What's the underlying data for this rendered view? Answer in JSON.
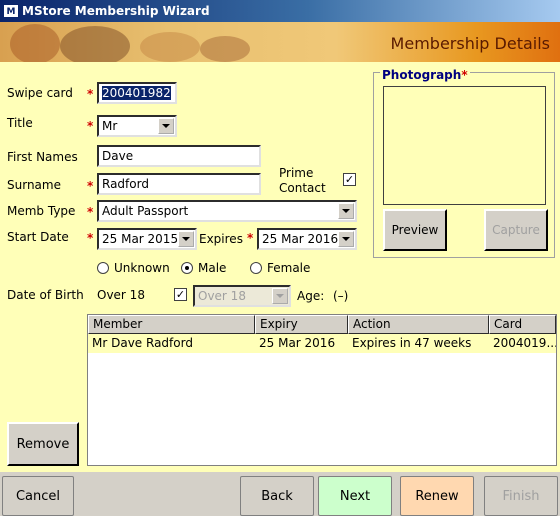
{
  "window": {
    "title": "MStore Membership Wizard",
    "logo": "M"
  },
  "banner": {
    "title": "Membership Details"
  },
  "form": {
    "swipe_card_label": "Swipe card",
    "swipe_card_value": "200401982",
    "title_label": "Title",
    "title_value": "Mr",
    "first_names_label": "First Names",
    "first_names_value": "Dave",
    "surname_label": "Surname",
    "surname_value": "Radford",
    "prime_contact_label_1": "Prime",
    "prime_contact_label_2": "Contact",
    "prime_contact_checked": "✓",
    "memb_type_label": "Memb Type",
    "memb_type_value": "Adult Passport",
    "start_date_label": "Start Date",
    "start_date_value": "25 Mar 2015",
    "expires_label": "Expires",
    "expires_value": "25 Mar 2016",
    "gender_unknown": "Unknown",
    "gender_male": "Male",
    "gender_female": "Female",
    "dob_label": "Date of Birth",
    "over18_label": "Over 18",
    "over18_checked": "✓",
    "over18_combo_value": "Over 18",
    "age_label": "Age:",
    "age_value": "(–)",
    "required_mark": "*"
  },
  "photo": {
    "legend": "Photograph",
    "preview_button": "Preview",
    "capture_button": "Capture"
  },
  "table": {
    "columns": [
      "Member",
      "Expiry",
      "Action",
      "Card"
    ],
    "rows": [
      {
        "member": "Mr Dave Radford",
        "expiry": "25 Mar 2016",
        "action": "Expires in 47 weeks",
        "card": "2004019..."
      }
    ]
  },
  "buttons": {
    "remove": "Remove",
    "cancel": "Cancel",
    "back": "Back",
    "next": "Next",
    "renew": "Renew",
    "finish": "Finish"
  },
  "colors": {
    "background": "#ffffb8",
    "required": "#d00000",
    "next_button": "#ccffcc",
    "renew_button": "#ffd8b0"
  }
}
